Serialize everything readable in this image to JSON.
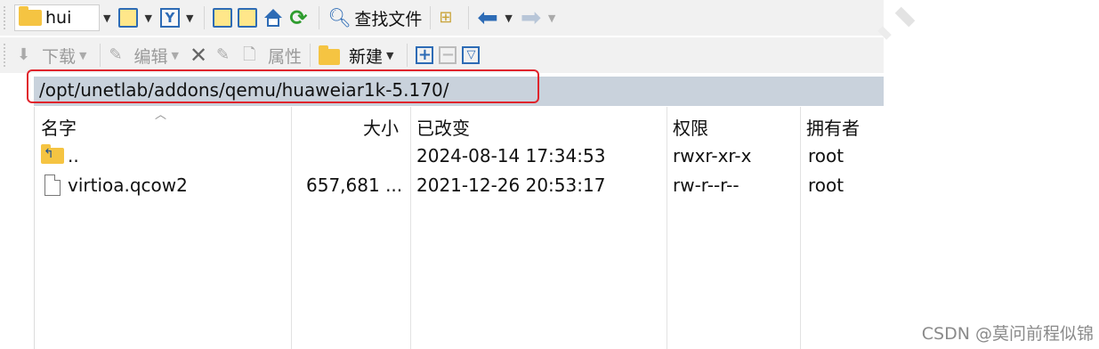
{
  "toolbar_top": {
    "drive_label": "huі",
    "find_files_label": "查找文件"
  },
  "toolbar_second": {
    "download_label": "下载",
    "edit_label": "编辑",
    "properties_label": "属性",
    "new_label": "新建"
  },
  "path": "/opt/unetlab/addons/qemu/huaweiar1k-5.170/",
  "columns": {
    "name": "名字",
    "size": "大小",
    "modified": "已改变",
    "permissions": "权限",
    "owner": "拥有者"
  },
  "files": [
    {
      "name": "..",
      "size": "",
      "modified": "2024-08-14 17:34:53",
      "permissions": "rwxr-xr-x",
      "owner": "root",
      "icon": "parent-folder-icon"
    },
    {
      "name": "virtioa.qcow2",
      "size": "657,681 ...",
      "modified": "2021-12-26 20:53:17",
      "permissions": "rw-r--r--",
      "owner": "root",
      "icon": "file-icon"
    }
  ],
  "watermark": "CSDN @莫问前程似锦",
  "colors": {
    "path_bar": "#c9d2dc",
    "highlight": "#e0242c",
    "folder": "#f5c442",
    "accent": "#2d6bb5"
  }
}
